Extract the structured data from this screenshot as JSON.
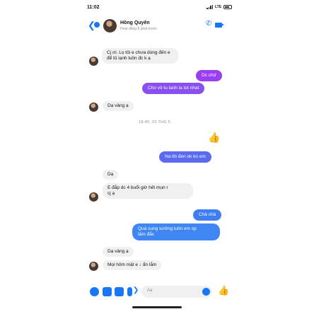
{
  "status_bar": {
    "time": "11:02",
    "network": "LTE"
  },
  "header": {
    "back_count": "",
    "contact_name": "Hồng Quyên",
    "subtitle": "Hoạt động 8 phút trước"
  },
  "messages": [
    {
      "dir": "in",
      "text": "Cj ơi. Lọ tôi e chưa dùng đến e\nđể tủ lạnh luôn đc k ạ"
    },
    {
      "dir": "out",
      "text": "Dc chứ",
      "color": "#9b3df2"
    },
    {
      "dir": "out",
      "text": "Cho vô tu lanh la tot nhat",
      "color": "#8a4ff0"
    },
    {
      "dir": "in",
      "text": "Dạ vâng ạ"
    },
    {
      "dir": "time",
      "text": "18:40, 23 THG 5"
    },
    {
      "dir": "out",
      "text": "Na tôi đen ok ko em",
      "color": "#5b6bf0"
    },
    {
      "dir": "in",
      "text": "Dạ"
    },
    {
      "dir": "in",
      "text": "E đắp dc 4 buổi giờ hết mụn r\ncj ạ"
    },
    {
      "dir": "out",
      "text": "Chà chà",
      "color": "#3f7ef2"
    },
    {
      "dir": "out",
      "text": "Quá sung sướng luôn em sp\ntâm đắc",
      "color": "#3f86f2"
    },
    {
      "dir": "in",
      "text": "Dạ vâng ạ"
    },
    {
      "dir": "in",
      "text": "Mọi hôm mặt e  ↓  ẩn lắm"
    }
  ],
  "composer": {
    "placeholder": "Aa"
  },
  "colors": {
    "accent": "#1877f2",
    "incoming_bubble": "#f0f0f0"
  },
  "icons": {
    "back": "chevron-left-icon",
    "call": "phone-icon",
    "video": "video-icon",
    "reaction": "thumbs-up-icon",
    "menu": "plus-circle-icon",
    "camera": "camera-icon",
    "gallery": "image-icon",
    "voice": "mic-icon",
    "emoji": "emoji-icon",
    "scroll": "arrow-down-icon"
  }
}
